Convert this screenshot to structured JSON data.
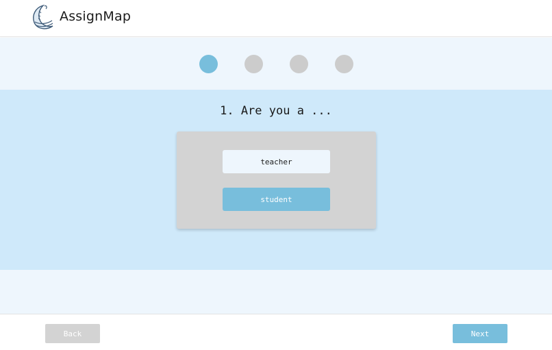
{
  "header": {
    "app_name": "AssignMap",
    "logo_icon": "moon-book-logo-icon"
  },
  "stepper": {
    "total_steps": 4,
    "current_step": 1,
    "active_color": "#78bedc",
    "inactive_color": "#cccccc"
  },
  "question": {
    "title": "1. Are you a ...",
    "options": [
      {
        "label": "teacher",
        "selected": false
      },
      {
        "label": "student",
        "selected": true
      }
    ]
  },
  "footer": {
    "back_label": "Back",
    "next_label": "Next",
    "back_enabled": false
  },
  "colors": {
    "accent": "#78bedc",
    "band_light": "#eef6fd",
    "band_blue": "#cfe9fa",
    "card_gray": "#d3d3d3"
  }
}
